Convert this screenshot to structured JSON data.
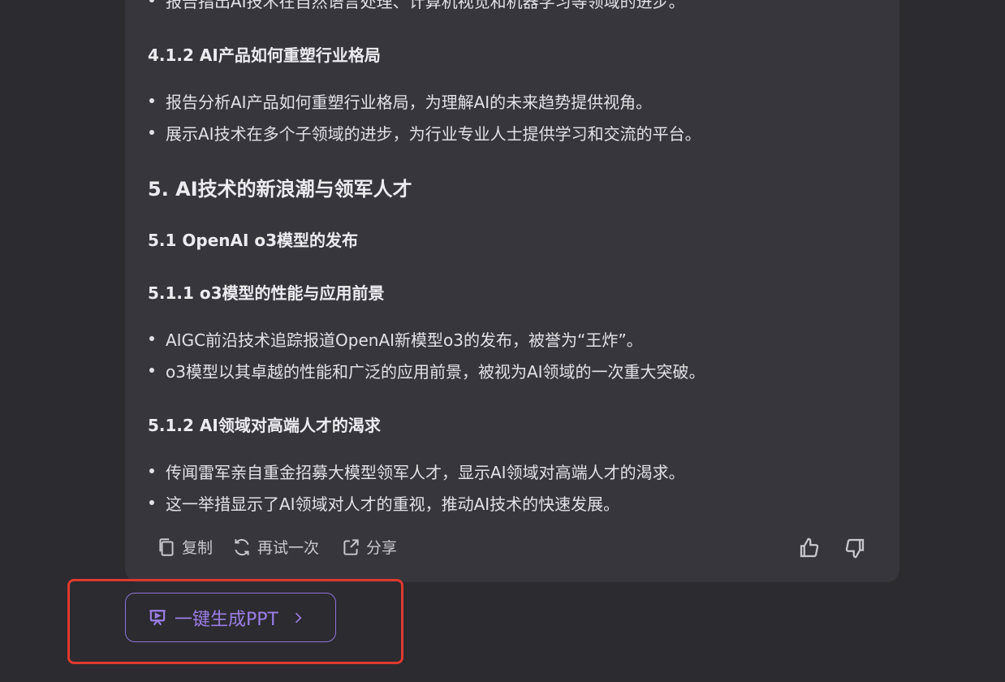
{
  "doc": {
    "line_top": "报告指出AI技术在自然语言处理、计算机视觉和机器学习等领域的进步。",
    "h_412": "4.1.2 AI产品如何重塑行业格局",
    "b_412": [
      "报告分析AI产品如何重塑行业格局，为理解AI的未来趋势提供视角。",
      "展示AI技术在多个子领域的进步，为行业专业人士提供学习和交流的平台。"
    ],
    "h_5": "5. AI技术的新浪潮与领军人才",
    "h_51": "5.1 OpenAI o3模型的发布",
    "h_511": "5.1.1 o3模型的性能与应用前景",
    "b_511": [
      "AIGC前沿技术追踪报道OpenAI新模型o3的发布，被誉为“王炸”。",
      "o3模型以其卓越的性能和广泛的应用前景，被视为AI领域的一次重大突破。"
    ],
    "h_512": "5.1.2 AI领域对高端人才的渴求",
    "b_512": [
      "传闻雷军亲自重金招募大模型领军人才，显示AI领域对高端人才的渴求。",
      "这一举措显示了AI领域对人才的重视，推动AI技术的快速发展。"
    ]
  },
  "actions": {
    "copy_label": "复制",
    "retry_label": "再试一次",
    "share_label": "分享",
    "icons": [
      "copy-icon",
      "refresh-icon",
      "share-icon",
      "thumbs-up-icon",
      "thumbs-down-icon"
    ]
  },
  "ppt": {
    "label": "一键生成PPT",
    "icon": "presentation-icon",
    "chevron_icon": "chevron-right-icon",
    "accent_color": "#9b7ee6",
    "highlight_color": "#e0392f"
  }
}
